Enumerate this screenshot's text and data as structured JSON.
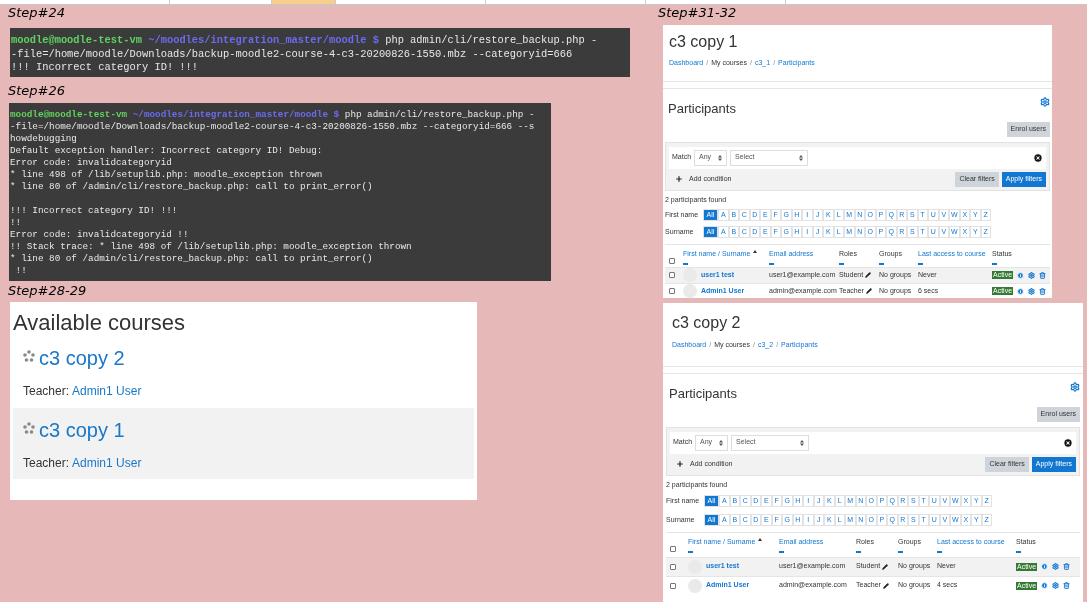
{
  "sheet": {
    "selected_column": true
  },
  "terminals": [
    {
      "step": "Step#24",
      "prompt": {
        "user": "moodle@moodle-test-vm",
        "path": "~/moodles/integration_master/moodle $",
        "command": "php admin/cli/restore_backup.php -"
      },
      "blocks": [
        [
          "-file=/home/moodle/Downloads/backup-moodle2-course-4-c3-20200826-1550.mbz --categoryid=666",
          "!!! Incorrect category ID! !!!"
        ]
      ]
    },
    {
      "step": "Step#26",
      "prompt": {
        "user": "moodle@moodle-test-vm",
        "path": "~/moodles/integration_master/moodle $",
        "command": "php admin/cli/restore_backup.php -"
      },
      "blocks": [
        [
          "-file=/home/moodle/Downloads/backup-moodle2-course-4-c3-20200826-1550.mbz --categoryid=666 --s",
          "howdebugging",
          "Default exception handler: Incorrect category ID! Debug:",
          "Error code: invalidcategoryid",
          "* line 498 of /lib/setuplib.php: moodle_exception thrown",
          "* line 80 of /admin/cli/restore_backup.php: call to print_error()"
        ],
        [
          "!!! Incorrect category ID! !!!",
          "!!",
          "Error code: invalidcategoryid !!",
          "!! Stack trace: * line 498 of /lib/setuplib.php: moodle_exception thrown",
          "* line 80 of /admin/cli/restore_backup.php: call to print_error()",
          " !!"
        ]
      ]
    }
  ],
  "course_list": {
    "step": "Step#28-29",
    "title": "Available courses",
    "courses": [
      {
        "name": "c3 copy 2",
        "teacher_label": "Teacher:",
        "teacher": "Admin1 User",
        "highlighted": false
      },
      {
        "name": "c3 copy 1",
        "teacher_label": "Teacher:",
        "teacher": "Admin1 User",
        "highlighted": true
      }
    ]
  },
  "participants_step": "Step#31-32",
  "participant_pages": [
    {
      "title": "c3 copy 1",
      "breadcrumb_separator": "/",
      "select_all_checked": false,
      "breadcrumb": [
        {
          "text": "Dashboard",
          "link": true
        },
        {
          "text": "My courses",
          "link": false
        },
        {
          "text": "c3_1",
          "link": true
        },
        {
          "text": "Participants",
          "link": true
        }
      ],
      "heading": "Participants",
      "enrol": "Enrol users",
      "match_label": "Match",
      "match_value": "Any",
      "condition_value": "Select",
      "add_condition": "Add condition",
      "clear": "Clear filters",
      "apply": "Apply filters",
      "found": "2 participants found",
      "first_name_label": "First name",
      "first_name_letters": [
        {
          "label": "All",
          "selected": true
        },
        {
          "label": "A",
          "selected": false
        },
        {
          "label": "B",
          "selected": false
        },
        {
          "label": "C",
          "selected": false
        },
        {
          "label": "D",
          "selected": false
        },
        {
          "label": "E",
          "selected": false
        },
        {
          "label": "F",
          "selected": false
        },
        {
          "label": "G",
          "selected": false
        },
        {
          "label": "H",
          "selected": false
        },
        {
          "label": "I",
          "selected": false
        },
        {
          "label": "J",
          "selected": false
        },
        {
          "label": "K",
          "selected": false
        },
        {
          "label": "L",
          "selected": false
        },
        {
          "label": "M",
          "selected": false
        },
        {
          "label": "N",
          "selected": false
        },
        {
          "label": "O",
          "selected": false
        },
        {
          "label": "P",
          "selected": false
        },
        {
          "label": "Q",
          "selected": false
        },
        {
          "label": "R",
          "selected": false
        },
        {
          "label": "S",
          "selected": false
        },
        {
          "label": "T",
          "selected": false
        },
        {
          "label": "U",
          "selected": false
        },
        {
          "label": "V",
          "selected": false
        },
        {
          "label": "W",
          "selected": false
        },
        {
          "label": "X",
          "selected": false
        },
        {
          "label": "Y",
          "selected": false
        },
        {
          "label": "Z",
          "selected": false
        }
      ],
      "surname_label": "Surname",
      "surname_letters": [
        {
          "label": "All",
          "selected": true
        },
        {
          "label": "A",
          "selected": false
        },
        {
          "label": "B",
          "selected": false
        },
        {
          "label": "C",
          "selected": false
        },
        {
          "label": "D",
          "selected": false
        },
        {
          "label": "E",
          "selected": false
        },
        {
          "label": "F",
          "selected": false
        },
        {
          "label": "G",
          "selected": false
        },
        {
          "label": "H",
          "selected": false
        },
        {
          "label": "I",
          "selected": false
        },
        {
          "label": "J",
          "selected": false
        },
        {
          "label": "K",
          "selected": false
        },
        {
          "label": "L",
          "selected": false
        },
        {
          "label": "M",
          "selected": false
        },
        {
          "label": "N",
          "selected": false
        },
        {
          "label": "O",
          "selected": false
        },
        {
          "label": "P",
          "selected": false
        },
        {
          "label": "Q",
          "selected": false
        },
        {
          "label": "R",
          "selected": false
        },
        {
          "label": "S",
          "selected": false
        },
        {
          "label": "T",
          "selected": false
        },
        {
          "label": "U",
          "selected": false
        },
        {
          "label": "V",
          "selected": false
        },
        {
          "label": "W",
          "selected": false
        },
        {
          "label": "X",
          "selected": false
        },
        {
          "label": "Y",
          "selected": false
        },
        {
          "label": "Z",
          "selected": false
        }
      ],
      "columns": [
        {
          "label": "First name / Surname",
          "link": true,
          "sorted": true
        },
        {
          "label": "Email address",
          "link": true,
          "sorted": false
        },
        {
          "label": "Roles",
          "link": false,
          "sorted": false
        },
        {
          "label": "Groups",
          "link": false,
          "sorted": false
        },
        {
          "label": "Last access to course",
          "link": true,
          "sorted": false
        },
        {
          "label": "Status",
          "link": false,
          "sorted": false
        }
      ],
      "rows": [
        {
          "name": "user1 test",
          "email": "user1@example.com",
          "role": "Student",
          "groups": "No groups",
          "last_access": "Never",
          "status": "Active",
          "highlighted": true,
          "checked": false
        },
        {
          "name": "Admin1 User",
          "email": "admin@example.com",
          "role": "Teacher",
          "groups": "No groups",
          "last_access": "6 secs",
          "status": "Active",
          "highlighted": false,
          "checked": false
        }
      ]
    },
    {
      "title": "c3 copy 2",
      "breadcrumb_separator": "/",
      "select_all_checked": false,
      "breadcrumb": [
        {
          "text": "Dashboard",
          "link": true
        },
        {
          "text": "My courses",
          "link": false
        },
        {
          "text": "c3_2",
          "link": true
        },
        {
          "text": "Participants",
          "link": true
        }
      ],
      "heading": "Participants",
      "enrol": "Enrol users",
      "match_label": "Match",
      "match_value": "Any",
      "condition_value": "Select",
      "add_condition": "Add condition",
      "clear": "Clear filters",
      "apply": "Apply filters",
      "found": "2 participants found",
      "first_name_label": "First name",
      "first_name_letters": [
        {
          "label": "All",
          "selected": true
        },
        {
          "label": "A",
          "selected": false
        },
        {
          "label": "B",
          "selected": false
        },
        {
          "label": "C",
          "selected": false
        },
        {
          "label": "D",
          "selected": false
        },
        {
          "label": "E",
          "selected": false
        },
        {
          "label": "F",
          "selected": false
        },
        {
          "label": "G",
          "selected": false
        },
        {
          "label": "H",
          "selected": false
        },
        {
          "label": "I",
          "selected": false
        },
        {
          "label": "J",
          "selected": false
        },
        {
          "label": "K",
          "selected": false
        },
        {
          "label": "L",
          "selected": false
        },
        {
          "label": "M",
          "selected": false
        },
        {
          "label": "N",
          "selected": false
        },
        {
          "label": "O",
          "selected": false
        },
        {
          "label": "P",
          "selected": false
        },
        {
          "label": "Q",
          "selected": false
        },
        {
          "label": "R",
          "selected": false
        },
        {
          "label": "S",
          "selected": false
        },
        {
          "label": "T",
          "selected": false
        },
        {
          "label": "U",
          "selected": false
        },
        {
          "label": "V",
          "selected": false
        },
        {
          "label": "W",
          "selected": false
        },
        {
          "label": "X",
          "selected": false
        },
        {
          "label": "Y",
          "selected": false
        },
        {
          "label": "Z",
          "selected": false
        }
      ],
      "surname_label": "Surname",
      "surname_letters": [
        {
          "label": "All",
          "selected": true
        },
        {
          "label": "A",
          "selected": false
        },
        {
          "label": "B",
          "selected": false
        },
        {
          "label": "C",
          "selected": false
        },
        {
          "label": "D",
          "selected": false
        },
        {
          "label": "E",
          "selected": false
        },
        {
          "label": "F",
          "selected": false
        },
        {
          "label": "G",
          "selected": false
        },
        {
          "label": "H",
          "selected": false
        },
        {
          "label": "I",
          "selected": false
        },
        {
          "label": "J",
          "selected": false
        },
        {
          "label": "K",
          "selected": false
        },
        {
          "label": "L",
          "selected": false
        },
        {
          "label": "M",
          "selected": false
        },
        {
          "label": "N",
          "selected": false
        },
        {
          "label": "O",
          "selected": false
        },
        {
          "label": "P",
          "selected": false
        },
        {
          "label": "Q",
          "selected": false
        },
        {
          "label": "R",
          "selected": false
        },
        {
          "label": "S",
          "selected": false
        },
        {
          "label": "T",
          "selected": false
        },
        {
          "label": "U",
          "selected": false
        },
        {
          "label": "V",
          "selected": false
        },
        {
          "label": "W",
          "selected": false
        },
        {
          "label": "X",
          "selected": false
        },
        {
          "label": "Y",
          "selected": false
        },
        {
          "label": "Z",
          "selected": false
        }
      ],
      "columns": [
        {
          "label": "First name / Surname",
          "link": true,
          "sorted": true
        },
        {
          "label": "Email address",
          "link": true,
          "sorted": false
        },
        {
          "label": "Roles",
          "link": false,
          "sorted": false
        },
        {
          "label": "Groups",
          "link": false,
          "sorted": false
        },
        {
          "label": "Last access to course",
          "link": true,
          "sorted": false
        },
        {
          "label": "Status",
          "link": false,
          "sorted": false
        }
      ],
      "rows": [
        {
          "name": "user1 test",
          "email": "user1@example.com",
          "role": "Student",
          "groups": "No groups",
          "last_access": "Never",
          "status": "Active",
          "highlighted": true,
          "checked": false
        },
        {
          "name": "Admin1 User",
          "email": "admin@example.com",
          "role": "Teacher",
          "groups": "No groups",
          "last_access": "4 secs",
          "status": "Active",
          "highlighted": false,
          "checked": false
        }
      ]
    }
  ]
}
